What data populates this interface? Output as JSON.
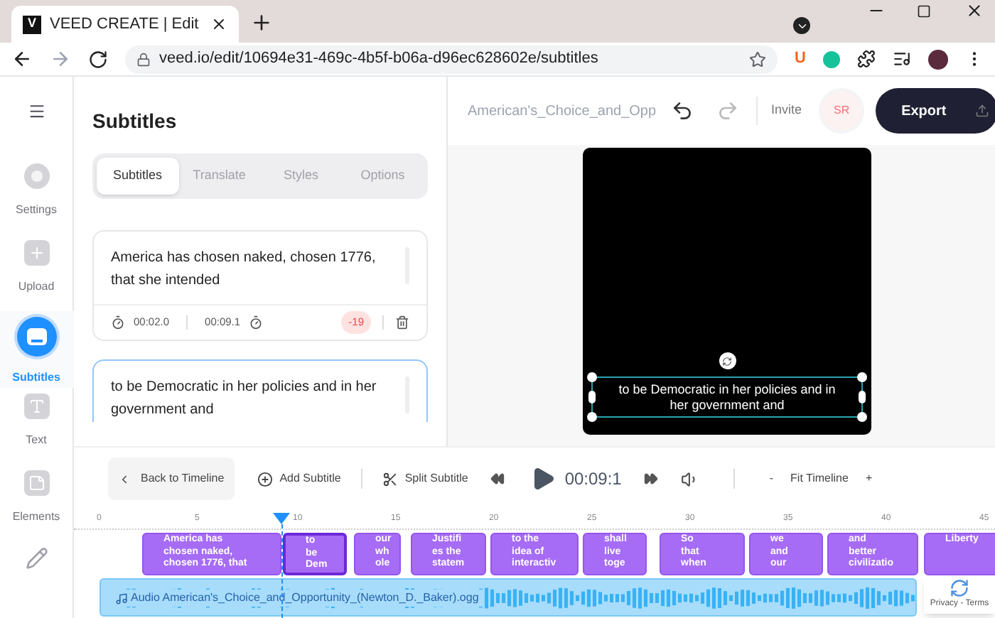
{
  "browser": {
    "tab": {
      "title": "VEED CREATE | Edit",
      "logo": "V"
    },
    "address": "veed.io/edit/10694e31-469c-4b5f-b06a-d96ec628602e/subtitles",
    "extension_badge": "U"
  },
  "rail": {
    "items": [
      {
        "label": "Settings",
        "selected": false,
        "kind": "settings"
      },
      {
        "label": "Upload",
        "selected": false,
        "kind": "upload"
      },
      {
        "label": "Subtitles",
        "selected": true,
        "kind": "subtitles"
      },
      {
        "label": "Text",
        "selected": false,
        "kind": "text"
      },
      {
        "label": "Elements",
        "selected": false,
        "kind": "elements"
      },
      {
        "selected": false,
        "kind": "draw"
      }
    ]
  },
  "panel": {
    "title": "Subtitles",
    "tabs": [
      {
        "label": "Subtitles",
        "selected": true
      },
      {
        "label": "Translate",
        "selected": false
      },
      {
        "label": "Styles",
        "selected": false
      },
      {
        "label": "Options",
        "selected": false
      }
    ],
    "cards": [
      {
        "text": "America has chosen naked, chosen 1776, that she intended",
        "start": "00:02.0",
        "end": "00:09.1",
        "badge": "-19",
        "selected": false
      },
      {
        "text": "to be Democratic in her policies and in her government and",
        "selected": true
      }
    ]
  },
  "topbar": {
    "filename": "American's_Choice_and_Opp",
    "invite": "Invite",
    "avatar": "SR",
    "export": "Export"
  },
  "preview": {
    "caption": "to be Democratic in her policies and in her government and"
  },
  "toolbar": {
    "back": "Back to Timeline",
    "add": "Add Subtitle",
    "split": "Split Subtitle",
    "time": "00:09:1",
    "zoom_out": "-",
    "fit": "Fit Timeline",
    "zoom_in": "+"
  },
  "timeline": {
    "ruler": [
      "0",
      "5",
      "10",
      "15",
      "20",
      "25",
      "30",
      "35",
      "40",
      "45"
    ],
    "clips": [
      {
        "lines": [
          "America has",
          "chosen naked,",
          "chosen 1776, that"
        ],
        "selected": false
      },
      {
        "lines": [
          "to",
          "be",
          "Dem"
        ],
        "selected": true
      },
      {
        "lines": [
          "our",
          "wh",
          "ole"
        ],
        "selected": false
      },
      {
        "lines": [
          "Justifi",
          "es the",
          "statem"
        ],
        "selected": false
      },
      {
        "lines": [
          "to the",
          "idea of",
          "interactiv"
        ],
        "selected": false
      },
      {
        "lines": [
          "shall",
          "live",
          "toge"
        ],
        "selected": false
      },
      {
        "lines": [
          "So",
          "that",
          "when"
        ],
        "selected": false
      },
      {
        "lines": [
          "we",
          "and",
          "our"
        ],
        "selected": false
      },
      {
        "lines": [
          "and",
          "better",
          "civilizatio"
        ],
        "selected": false
      },
      {
        "lines": [
          "Liberty"
        ],
        "selected": false
      }
    ],
    "audio": "Audio American's_Choice_and_Opportunity_(Newton_D._Baker).ogg"
  },
  "recaptcha": {
    "links": "Privacy - Terms"
  }
}
